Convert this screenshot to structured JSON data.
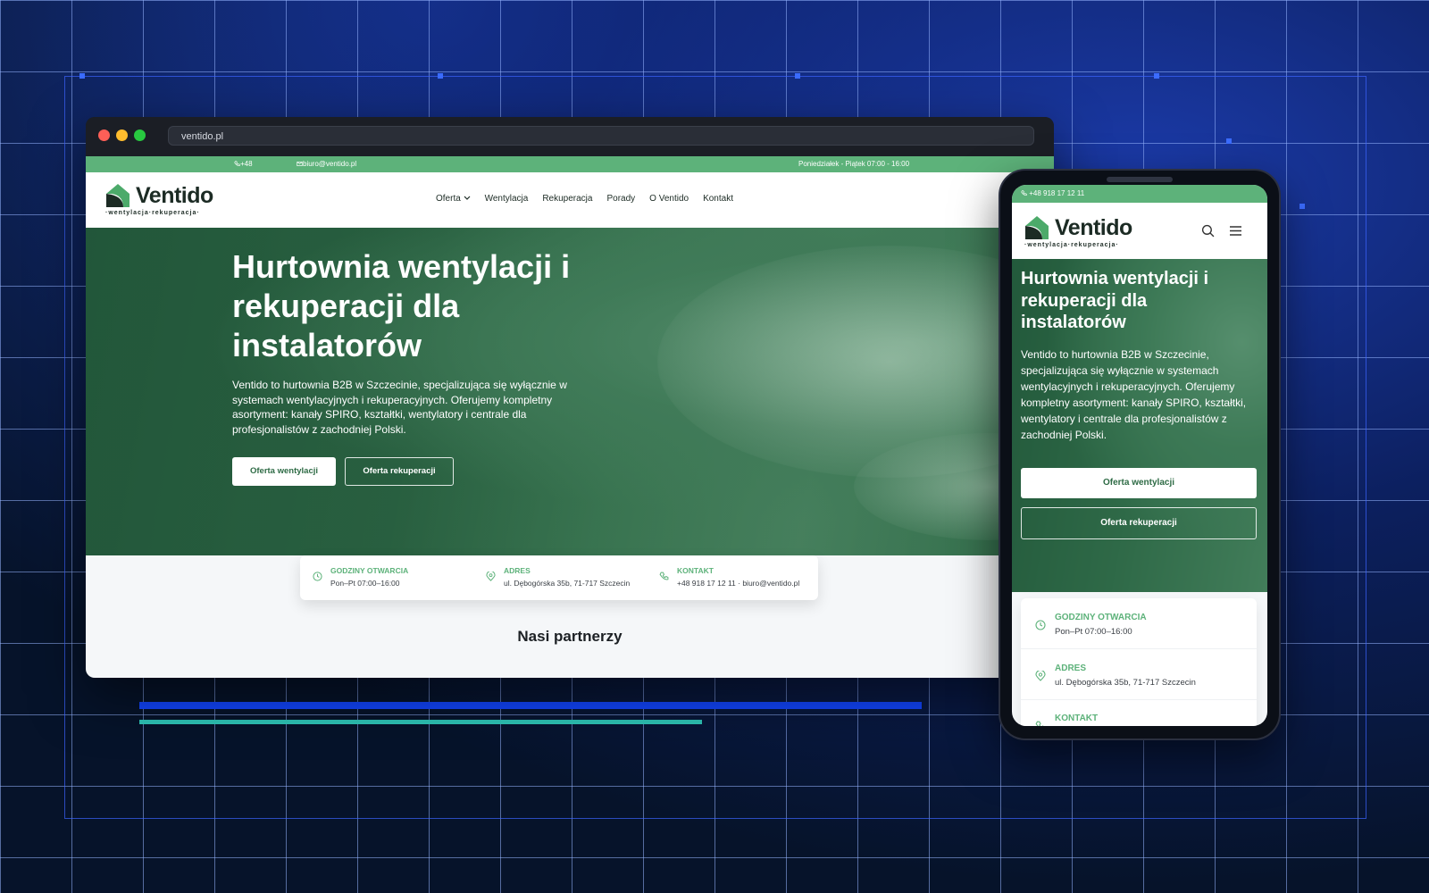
{
  "browser": {
    "url": "ventido.pl"
  },
  "site": {
    "topbar": {
      "phone": "+48 918 17 12 11",
      "email": "biuro@ventido.pl",
      "hours": "Poniedziałek - Piątek 07:00 - 16:00"
    },
    "logo": {
      "name": "Ventido",
      "tagline": "·wentylacja·rekuperacja·"
    },
    "menu": {
      "oferta": "Oferta",
      "wentylacja": "Wentylacja",
      "rekuperacja": "Rekuperacja",
      "porady": "Porady",
      "o_ventido": "O Ventido",
      "kontakt": "Kontakt"
    },
    "hero": {
      "title": "Hurtownia wentylacji i rekuperacji dla instalatorów",
      "description": "Ventido to hurtownia B2B w Szczecinie, specjalizująca się wyłącznie w systemach wentylacyjnych i rekuperacyjnych. Oferujemy kompletny asortyment: kanały SPIRO, kształtki, wentylatory i centrale dla profesjonalistów z zachodniej Polski.",
      "btn_primary": "Oferta wentylacji",
      "btn_secondary": "Oferta rekuperacji"
    },
    "info": {
      "hours_label": "GODZINY OTWARCIA",
      "hours_value": "Pon–Pt 07:00–16:00",
      "address_label": "ADRES",
      "address_value": "ul. Dębogórska 35b, 71-717 Szczecin",
      "contact_label": "KONTAKT",
      "contact_value": "+48 918 17 12 11 · biuro@ventido.pl"
    },
    "partners_title": "Nasi partnerzy"
  },
  "mobile": {
    "topbar_phone": "+48 918 17 12 11"
  },
  "colors": {
    "brand_green": "#5db27a",
    "background": "#06132a",
    "accent_blue": "#1246ff",
    "accent_teal": "#2ec4b6"
  },
  "icons": [
    "phone-icon",
    "mail-icon",
    "chevron-down-icon",
    "search-icon",
    "hamburger-icon",
    "clock-icon",
    "map-pin-icon"
  ]
}
